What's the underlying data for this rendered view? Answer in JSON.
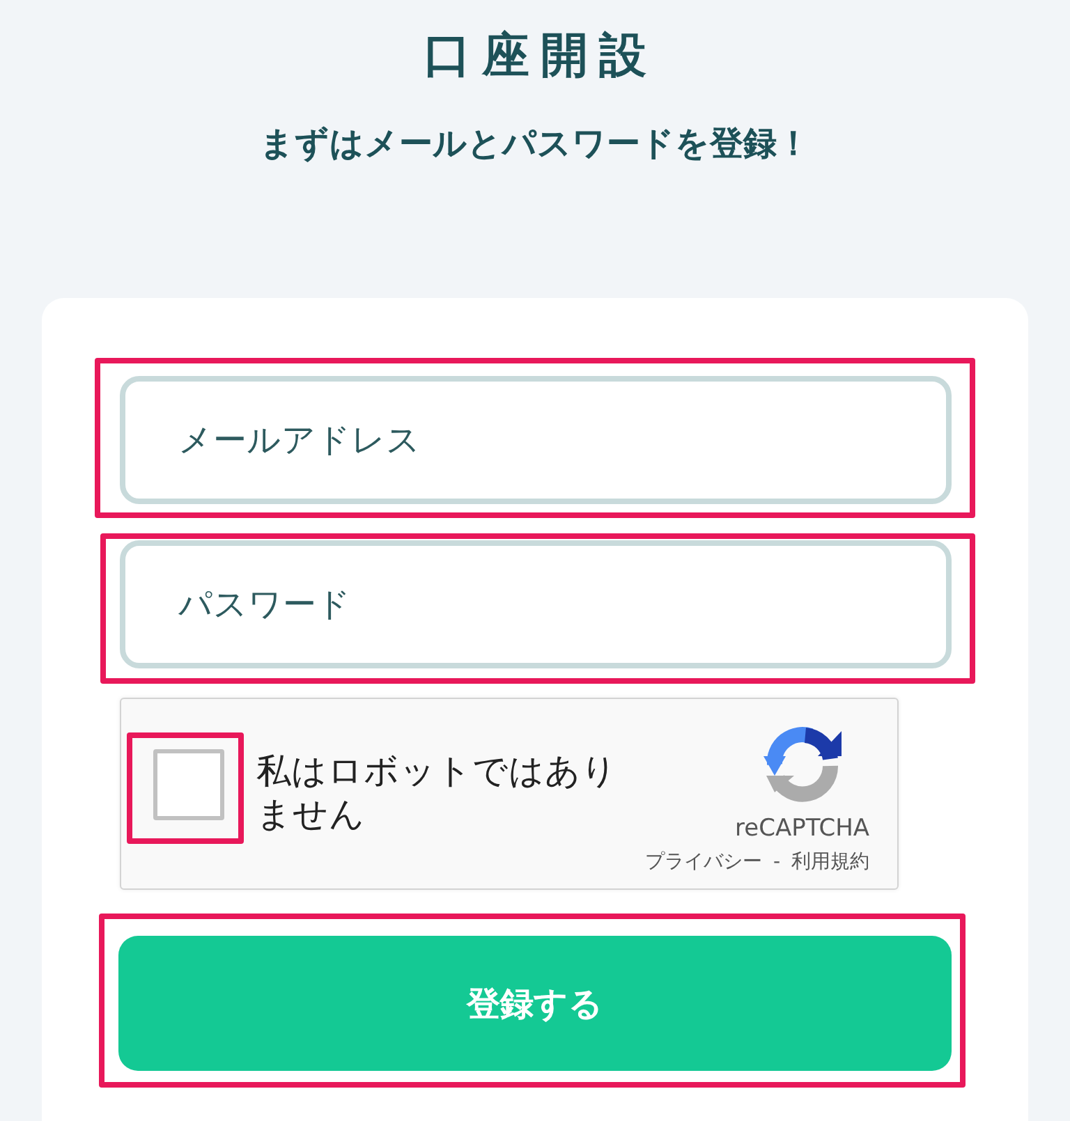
{
  "page": {
    "title": "口座開設",
    "subtitle": "まずはメールとパスワードを登録！"
  },
  "form": {
    "fields": [
      {
        "placeholder": "メールアドレス",
        "highlighted": true
      },
      {
        "placeholder": "パスワード",
        "highlighted": true
      }
    ],
    "captcha": {
      "label": "私はロボットではありません",
      "checked": false,
      "highlighted": true,
      "brand": "reCAPTCHA",
      "links": [
        "プライバシー",
        "利用規約"
      ],
      "separator": "-"
    },
    "submit": {
      "label": "登録する",
      "highlighted": true
    }
  }
}
